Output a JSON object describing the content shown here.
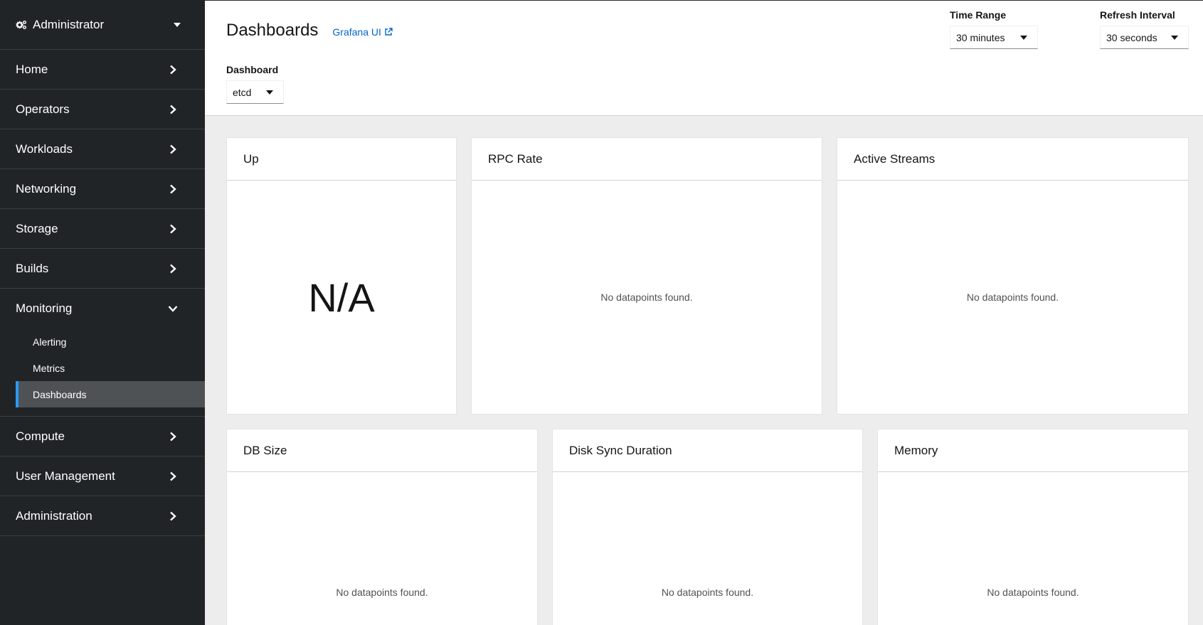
{
  "sidebar": {
    "perspective": "Administrator",
    "groups": [
      {
        "label": "Home"
      },
      {
        "label": "Operators"
      },
      {
        "label": "Workloads"
      },
      {
        "label": "Networking"
      },
      {
        "label": "Storage"
      },
      {
        "label": "Builds"
      },
      {
        "label": "Monitoring",
        "expanded": true,
        "items": [
          {
            "label": "Alerting"
          },
          {
            "label": "Metrics"
          },
          {
            "label": "Dashboards",
            "active": true
          }
        ]
      },
      {
        "label": "Compute"
      },
      {
        "label": "User Management"
      },
      {
        "label": "Administration"
      }
    ]
  },
  "header": {
    "title": "Dashboards",
    "grafana_link": "Grafana UI",
    "dashboard_label": "Dashboard",
    "dashboard_value": "etcd",
    "time_range_label": "Time Range",
    "time_range_value": "30 minutes",
    "refresh_label": "Refresh Interval",
    "refresh_value": "30 seconds"
  },
  "panels": {
    "up": {
      "title": "Up",
      "value": "N/A"
    },
    "rpc_rate": {
      "title": "RPC Rate",
      "message": "No datapoints found."
    },
    "active_streams": {
      "title": "Active Streams",
      "message": "No datapoints found."
    },
    "db_size": {
      "title": "DB Size",
      "message": "No datapoints found."
    },
    "disk_sync": {
      "title": "Disk Sync Duration",
      "message": "No datapoints found."
    },
    "memory": {
      "title": "Memory",
      "message": "No datapoints found."
    }
  },
  "colors": {
    "sidebar_bg": "#212427",
    "active_accent": "#2b9af3",
    "link": "#0066cc"
  }
}
